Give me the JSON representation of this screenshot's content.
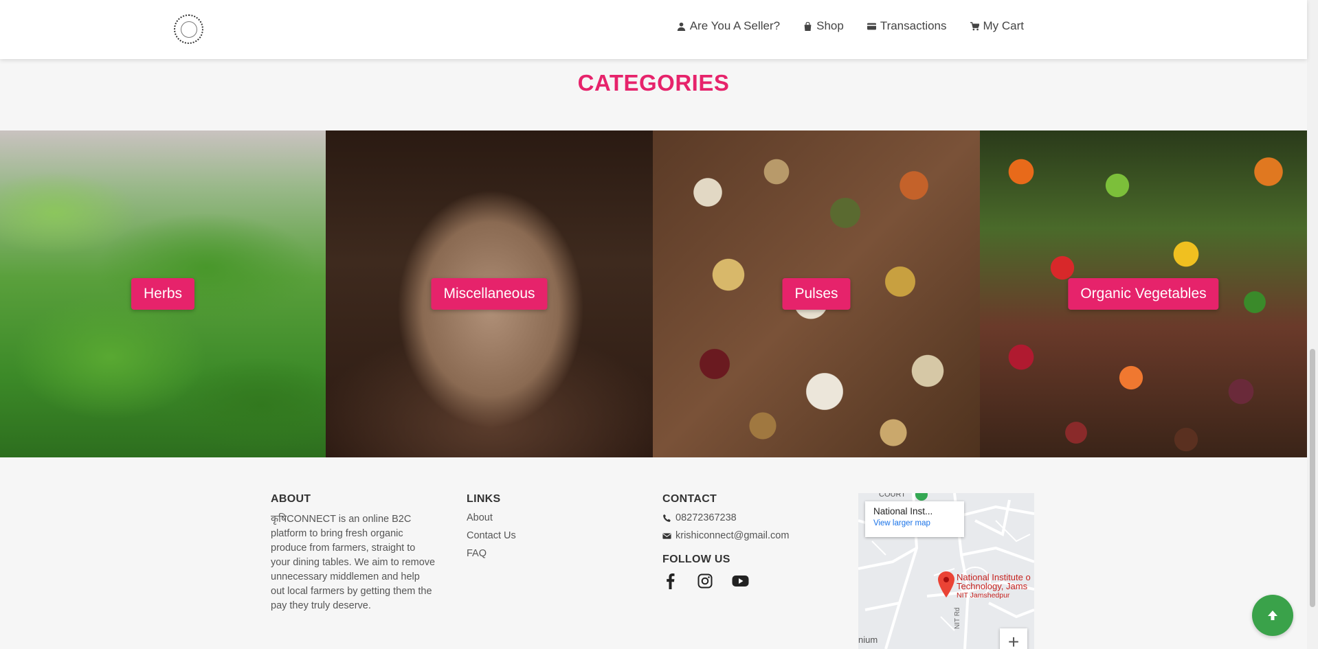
{
  "header": {
    "nav": [
      {
        "label": "Are You A Seller?",
        "icon": "user-icon"
      },
      {
        "label": "Shop",
        "icon": "bag-icon"
      },
      {
        "label": "Transactions",
        "icon": "card-icon"
      },
      {
        "label": "My Cart",
        "icon": "cart-icon"
      }
    ]
  },
  "categories": {
    "title": "CATEGORIES",
    "items": [
      {
        "label": "Herbs"
      },
      {
        "label": "Miscellaneous"
      },
      {
        "label": "Pulses"
      },
      {
        "label": "Organic Vegetables"
      }
    ]
  },
  "footer": {
    "about": {
      "heading": "ABOUT",
      "text": "कृषिCONNECT is an online B2C platform to bring fresh organic produce from farmers, straight to your dining tables. We aim to remove unnecessary middlemen and help out local farmers by getting them the pay they truly deserve."
    },
    "links": {
      "heading": "LINKS",
      "items": [
        "About",
        "Contact Us",
        "FAQ"
      ]
    },
    "contact": {
      "heading": "CONTACT",
      "phone": "08272367238",
      "email": "krishiconnect@gmail.com"
    },
    "follow": {
      "heading": "FOLLOW US",
      "icons": [
        "facebook-icon",
        "instagram-icon",
        "youtube-icon"
      ]
    },
    "map": {
      "place_title": "National Inst...",
      "view_larger": "View larger map",
      "marker_label_line1": "National Institute o",
      "marker_label_line2": "Technology, Jams",
      "marker_sub": "NIT Jamshedpur",
      "road_label": "NIT Rd",
      "top_label": "COURT",
      "edge_label": "nium",
      "zoom_in": "+"
    }
  },
  "colors": {
    "accent": "#e6236b",
    "back_to_top": "#3aa24a",
    "map_link": "#1a73e8",
    "map_marker": "#c5221f"
  }
}
